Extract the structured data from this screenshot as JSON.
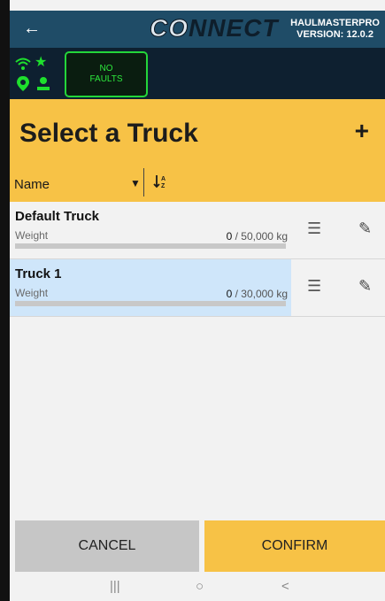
{
  "topbar": {
    "back_icon": "arrow-left-icon",
    "logo_co": "CO",
    "logo_rest": "NNECT",
    "brand_line1": "HAULMASTERPRO",
    "brand_line2": "VERSION: 12.0.2"
  },
  "status": {
    "icons": [
      "wifi-icon",
      "star-icon",
      "location-pin-icon",
      "user-icon"
    ],
    "faults_line1": "NO",
    "faults_line2": "FAULTS",
    "accent": "#24d53a"
  },
  "header": {
    "title": "Select a Truck",
    "add_glyph": "+",
    "sort_field": "Name",
    "sort_icon_label": "↓A/Z"
  },
  "trucks": [
    {
      "name": "Default Truck",
      "weight_label": "Weight",
      "current": "0",
      "capacity": "/ 50,000 kg",
      "fill_fraction": 0,
      "selected": false
    },
    {
      "name": "Truck 1",
      "weight_label": "Weight",
      "current": "0",
      "capacity": "/ 30,000 kg",
      "fill_fraction": 0,
      "selected": true
    }
  ],
  "actions": {
    "cancel": "CANCEL",
    "confirm": "CONFIRM"
  },
  "colors": {
    "topbar": "#1f4c67",
    "header": "#f7c246",
    "selected_row": "#cfe6fa",
    "cancel": "#c6c6c6",
    "confirm": "#f7c246"
  },
  "navigation": {
    "recent": "|||",
    "home": "○",
    "back": "<"
  }
}
